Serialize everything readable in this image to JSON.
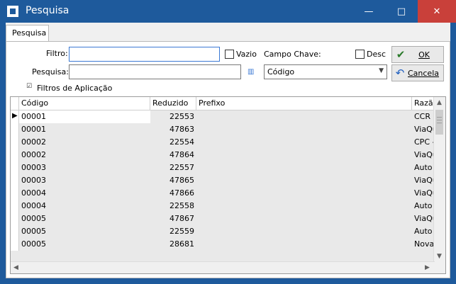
{
  "window": {
    "title": "Pesquisa",
    "minimize_glyph": "—",
    "maximize_glyph": "□",
    "close_glyph": "✕",
    "accent": "#1e5a9c"
  },
  "tab": {
    "label": "Pesquisa"
  },
  "form": {
    "filtro_label": "Filtro:",
    "filtro_value": "",
    "vazio_label": "Vazio",
    "vazio_checked": false,
    "campo_chave_label": "Campo Chave:",
    "desc_label": "Desc",
    "desc_checked": false,
    "pesquisa_label": "Pesquisa:",
    "pesquisa_value": "",
    "campo_chave_value": "Código",
    "filtros_aplicacao_label": "Filtros de Aplicação"
  },
  "buttons": {
    "ok_label": "OK",
    "cancel_label": "Cancela"
  },
  "grid": {
    "columns": [
      "Código",
      "Reduzido",
      "Prefixo",
      "Razão"
    ],
    "rows": [
      {
        "codigo": "00001",
        "reduzido": "22553",
        "prefixo": "",
        "razao": "CCR -"
      },
      {
        "codigo": "00001",
        "reduzido": "47863",
        "prefixo": "",
        "razao": "ViaQu"
      },
      {
        "codigo": "00002",
        "reduzido": "22554",
        "prefixo": "",
        "razao": "CPC -"
      },
      {
        "codigo": "00002",
        "reduzido": "47864",
        "prefixo": "",
        "razao": "ViaQu"
      },
      {
        "codigo": "00003",
        "reduzido": "22557",
        "prefixo": "",
        "razao": "Auto"
      },
      {
        "codigo": "00003",
        "reduzido": "47865",
        "prefixo": "",
        "razao": "ViaQu"
      },
      {
        "codigo": "00004",
        "reduzido": "47866",
        "prefixo": "",
        "razao": "ViaQu"
      },
      {
        "codigo": "00004",
        "reduzido": "22558",
        "prefixo": "",
        "razao": "Auto"
      },
      {
        "codigo": "00005",
        "reduzido": "47867",
        "prefixo": "",
        "razao": "ViaQu"
      },
      {
        "codigo": "00005",
        "reduzido": "22559",
        "prefixo": "",
        "razao": "Auto"
      },
      {
        "codigo": "00005",
        "reduzido": "28681",
        "prefixo": "",
        "razao": "Nova"
      }
    ]
  }
}
